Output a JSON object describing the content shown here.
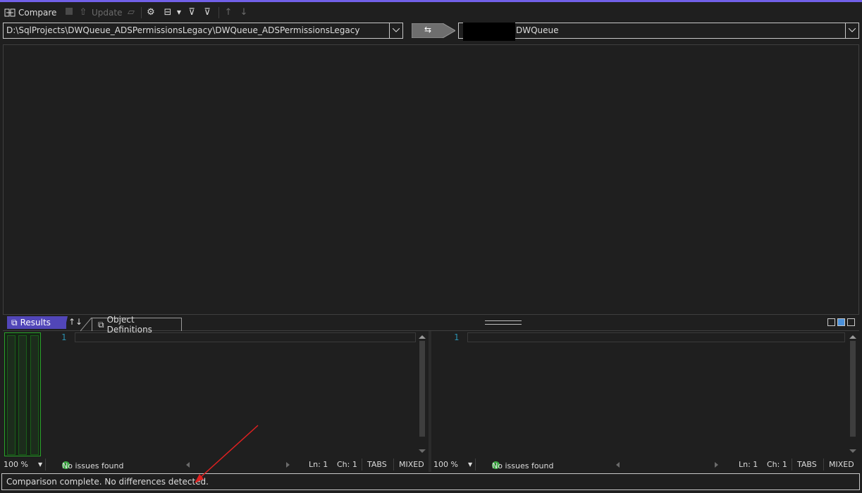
{
  "toolbar": {
    "compare_label": "Compare",
    "update_label": "Update"
  },
  "source": {
    "path": "D:\\SqlProjects\\DWQueue_ADSPermissionsLegacy\\DWQueue_ADSPermissionsLegacy"
  },
  "target": {
    "value": "DWQueue"
  },
  "tabs": {
    "results_label": "Results",
    "object_definitions_label": "Object Definitions"
  },
  "left_editor": {
    "line_number": "1",
    "zoom": "100 %",
    "issues": "No issues found",
    "ln": "Ln: 1",
    "ch": "Ch: 1",
    "tabs": "TABS",
    "line_endings": "MIXED"
  },
  "right_editor": {
    "line_number": "1",
    "zoom": "100 %",
    "issues": "No issues found",
    "ln": "Ln: 1",
    "ch": "Ch: 1",
    "tabs": "TABS",
    "line_endings": "MIXED"
  },
  "status": {
    "message": "Comparison complete.  No differences detected."
  },
  "colors": {
    "accent": "#7160e8",
    "results_tab": "#5146b8",
    "ok": "#3cb043",
    "annotation": "#e02020"
  }
}
